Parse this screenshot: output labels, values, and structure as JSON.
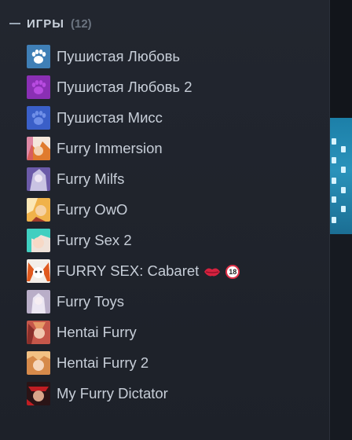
{
  "section": {
    "title": "ИГРЫ",
    "count": "(12)"
  },
  "games": [
    {
      "name": "Пушистая Любовь",
      "icon": "paw-icon"
    },
    {
      "name": "Пушистая Любовь 2",
      "icon": "paw-icon"
    },
    {
      "name": "Пушистая Мисс",
      "icon": "paw-icon"
    },
    {
      "name": "Furry Immersion",
      "icon": "game-art-icon"
    },
    {
      "name": "Furry Milfs",
      "icon": "game-art-icon"
    },
    {
      "name": "Furry OwO",
      "icon": "game-art-icon"
    },
    {
      "name": "Furry Sex 2",
      "icon": "game-art-icon"
    },
    {
      "name": "FURRY SEX: Cabaret",
      "icon": "game-art-icon",
      "suffix_emoji": [
        "lips-emoji",
        "no-under-18-emoji"
      ],
      "badge_text": "18"
    },
    {
      "name": "Furry Toys",
      "icon": "game-art-icon"
    },
    {
      "name": "Hentai Furry",
      "icon": "game-art-icon"
    },
    {
      "name": "Hentai Furry 2",
      "icon": "game-art-icon"
    },
    {
      "name": "My Furry Dictator",
      "icon": "game-art-icon"
    }
  ],
  "colors": {
    "background": "#1f232c",
    "text": "#c7ced8",
    "muted": "#6b7480",
    "accent_blue": "#2a93bb"
  }
}
